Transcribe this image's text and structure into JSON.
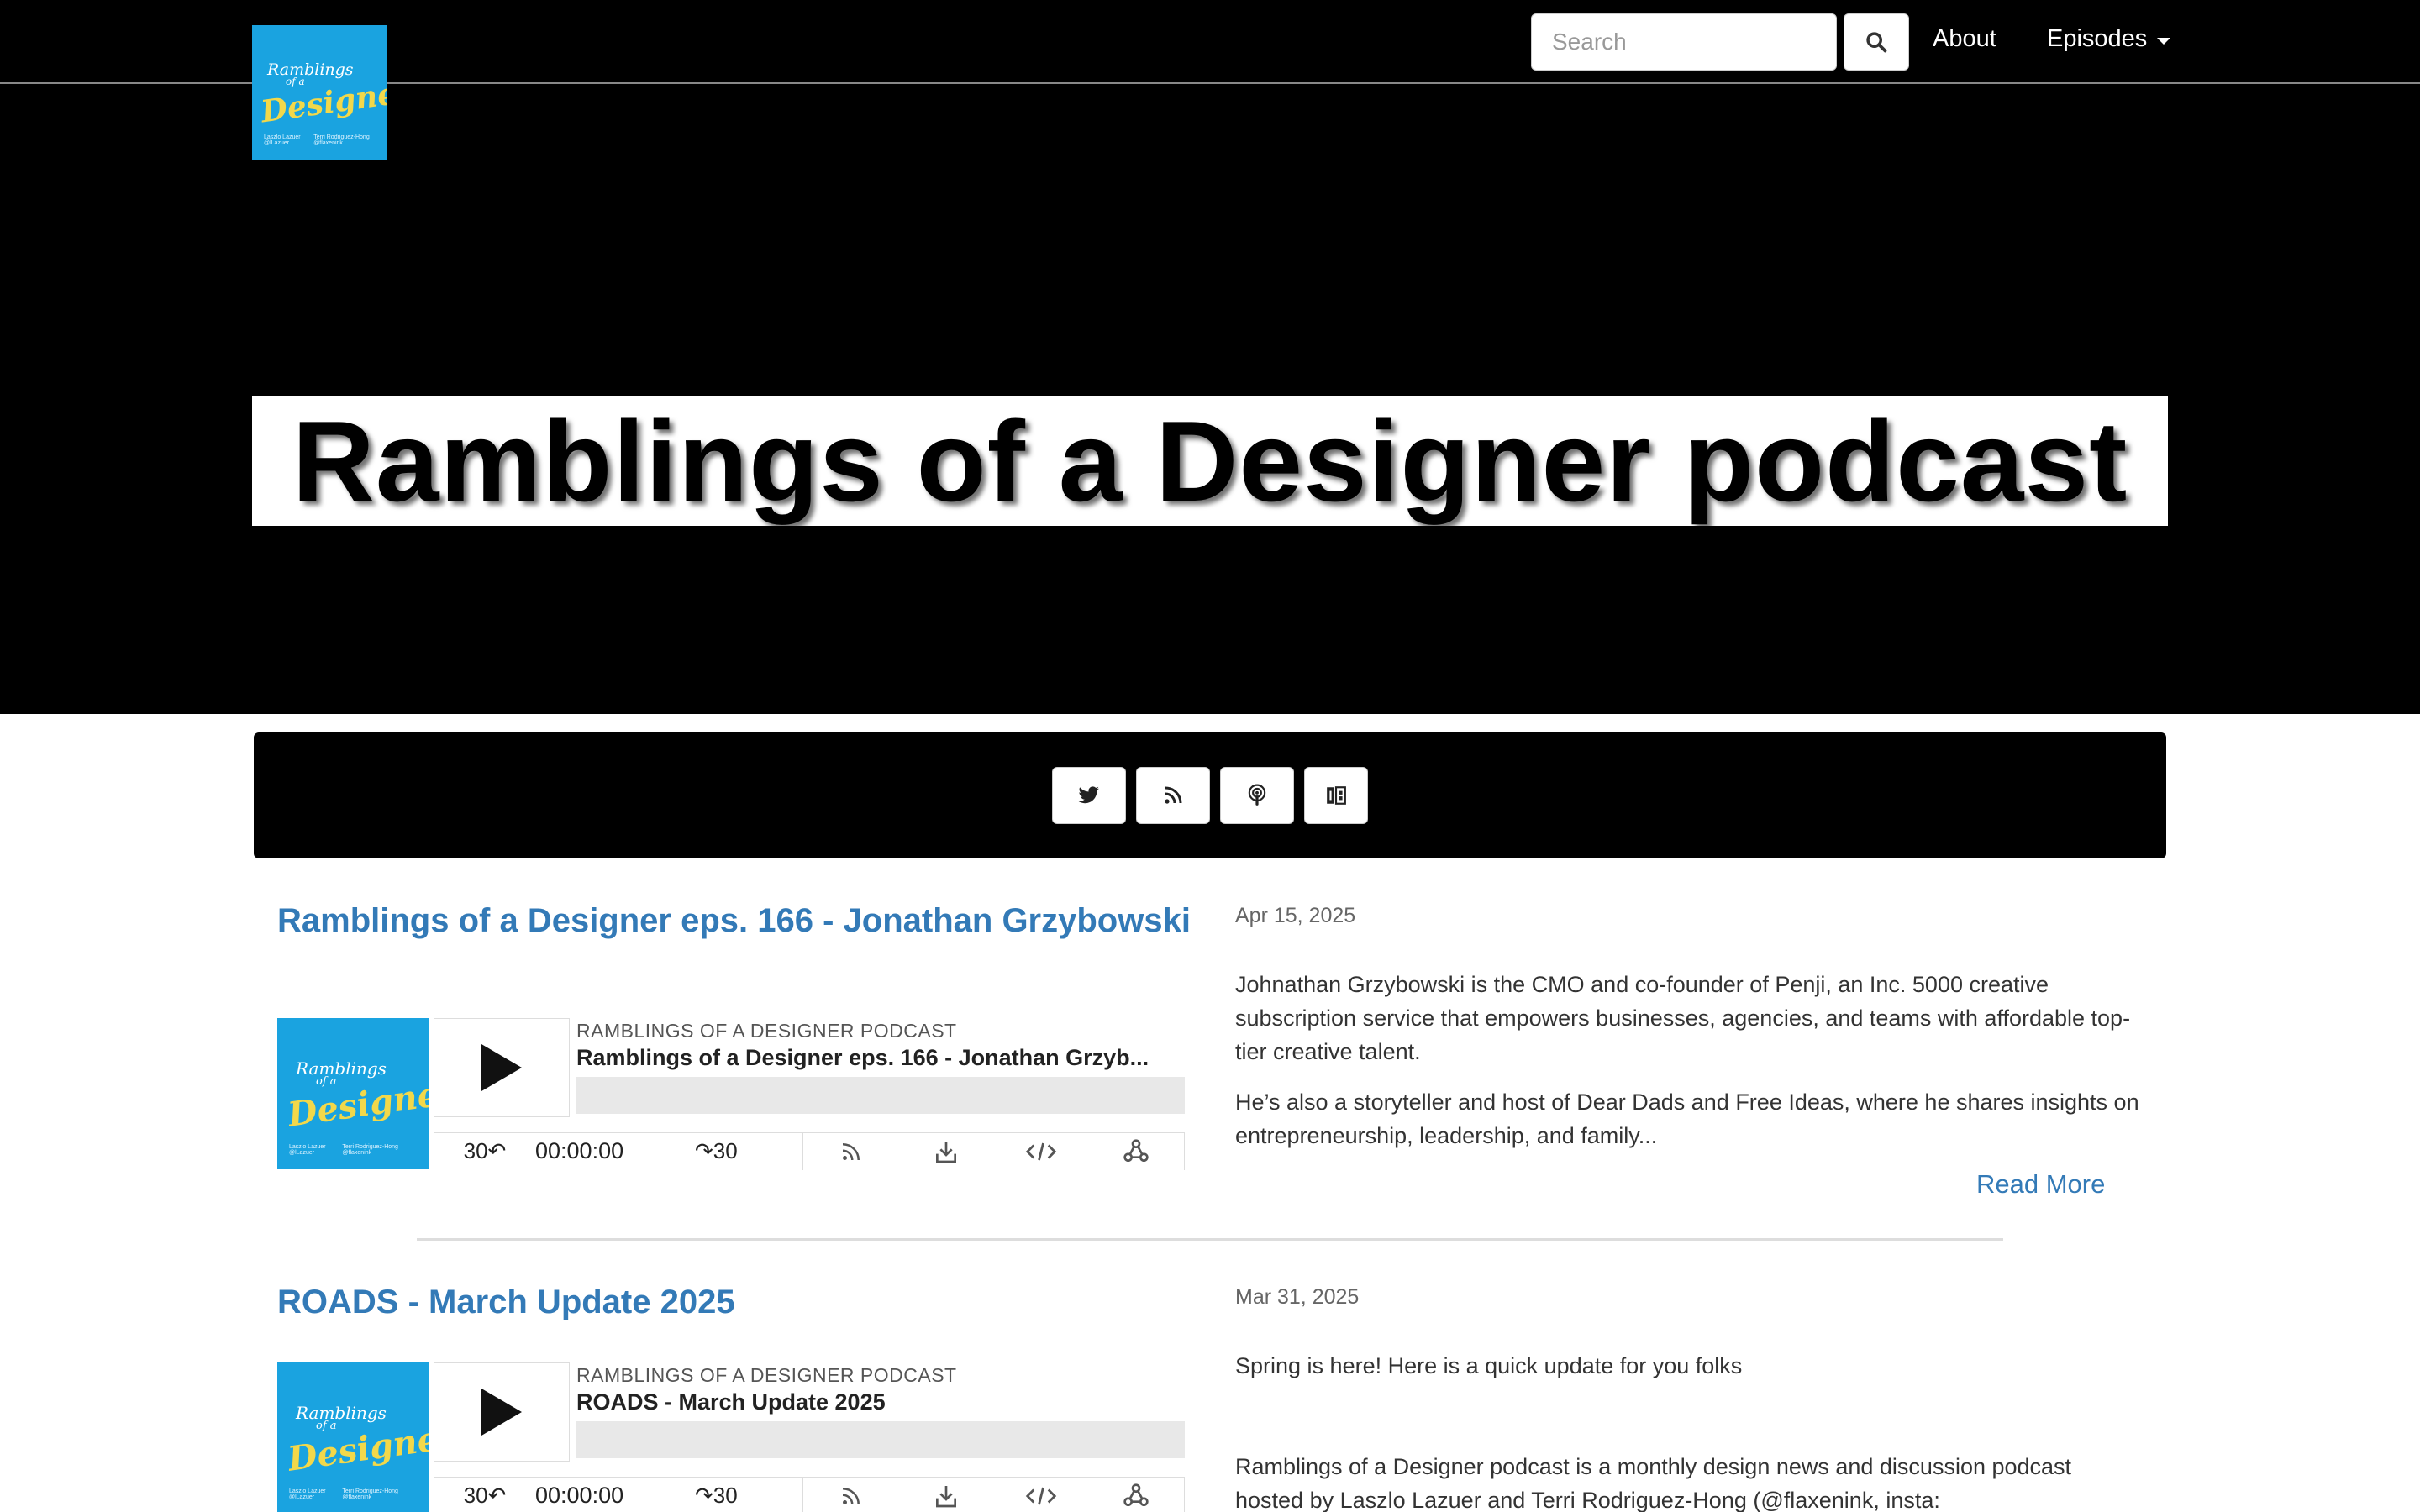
{
  "header": {
    "search_placeholder": "Search",
    "nav_about": "About",
    "nav_episodes": "Episodes",
    "logo_text": {
      "line1": "Ramblings",
      "line2": "of a",
      "line3": "Designer",
      "host_a": "Laszlo Lazuer @lLazuer",
      "host_b": "Terri Rodriguez-Hong @flaxenink"
    }
  },
  "hero": {
    "title": "Ramblings of a Designer podcast"
  },
  "social": {
    "icons": [
      "twitter-icon",
      "rss-icon",
      "podcast-icon",
      "podcast-app-icon"
    ]
  },
  "colors": {
    "link_blue": "#337ab7",
    "logo_blue": "#1aa3e0",
    "logo_yellow": "#f2d84a",
    "header_bg": "#000000"
  },
  "episodes": [
    {
      "title": "Ramblings of a Designer eps. 166 - Jonathan Grzybowski",
      "date": "Apr 15, 2025",
      "player": {
        "show": "RAMBLINGS OF A DESIGNER PODCAST",
        "episode": "Ramblings of a Designer eps. 166 - Jonathan Grzyb...",
        "back": "30↶",
        "time": "00:00:00",
        "forward": "↷30"
      },
      "paragraphs": [
        "Johnathan Grzybowski is the CMO and co-founder of Penji, an Inc. 5000 creative subscription service that empowers businesses, agencies, and teams with affordable top-tier creative talent.",
        "He’s also a storyteller and host of Dear Dads and Free Ideas, where he shares insights on entrepreneurship, leadership, and family..."
      ],
      "read_more": "Read More"
    },
    {
      "title": "ROADS - March Update 2025",
      "date": "Mar 31, 2025",
      "player": {
        "show": "RAMBLINGS OF A DESIGNER PODCAST",
        "episode": "ROADS - March Update 2025",
        "back": "30↶",
        "time": "00:00:00",
        "forward": "↷30"
      },
      "paragraphs": [
        "Spring is here! Here is a quick update for you folks",
        "Ramblings of a Designer podcast is a monthly design news and discussion podcast hosted by Laszlo Lazuer and Terri Rodriguez-Hong (@flaxenink, insta:"
      ]
    }
  ]
}
